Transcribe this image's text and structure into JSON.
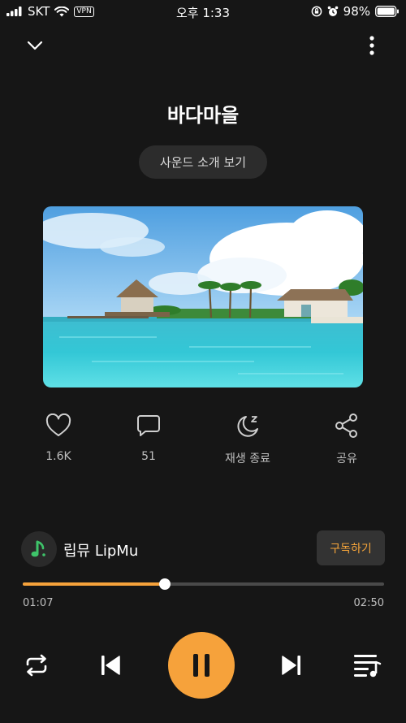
{
  "status_bar": {
    "carrier": "SKT",
    "vpn": "VPN",
    "time": "오후 1:33",
    "battery": "98%"
  },
  "header": {
    "title": "바다마을",
    "intro_button": "사운드 소개 보기"
  },
  "actions": {
    "like_count": "1.6K",
    "comment_count": "51",
    "sleep_timer_label": "재생 종료",
    "share_label": "공유"
  },
  "channel": {
    "name": "립뮤 LipMu",
    "subscribe_label": "구독하기"
  },
  "player": {
    "current_time": "01:07",
    "total_time": "02:50",
    "progress_fraction": 0.394
  },
  "colors": {
    "accent": "#f6a23b",
    "background": "#161616"
  },
  "icons": [
    "signal-icon",
    "wifi-icon",
    "orientation-lock-icon",
    "alarm-icon",
    "battery-icon",
    "chevron-down-icon",
    "more-vertical-icon",
    "heart-icon",
    "comment-icon",
    "moon-z-icon",
    "share-icon",
    "repeat-icon",
    "skip-previous-icon",
    "pause-icon",
    "skip-next-icon",
    "playlist-icon"
  ]
}
